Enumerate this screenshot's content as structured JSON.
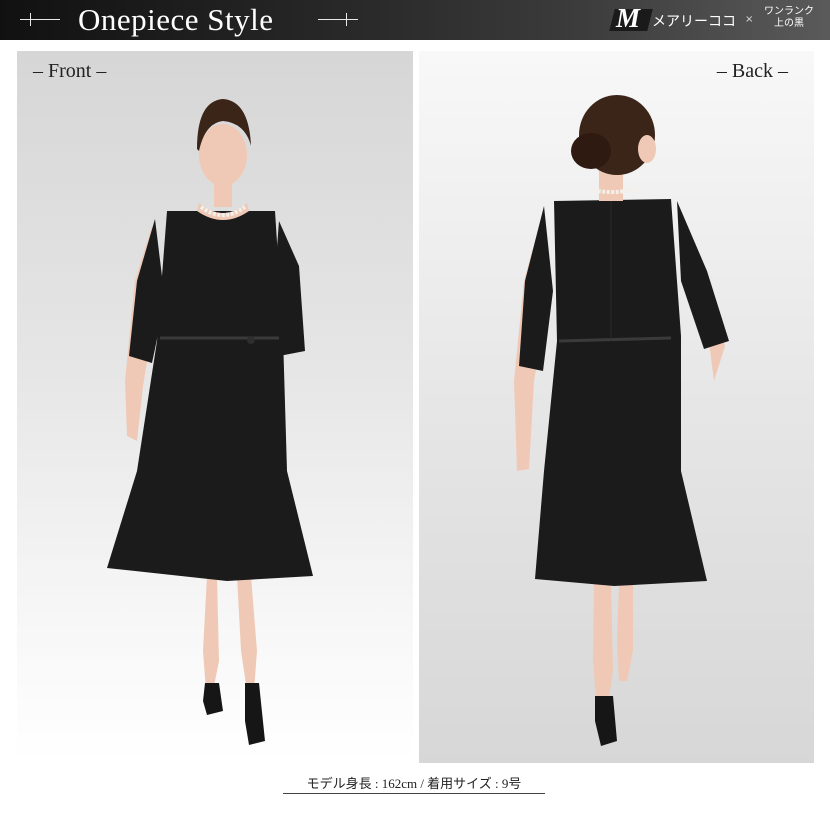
{
  "header": {
    "title": "Onepiece Style",
    "brand": {
      "logo_letter": "M",
      "name": "メアリーココ",
      "separator": "×",
      "sub_line1": "ワンランク",
      "sub_line2": "上の黒"
    }
  },
  "panels": {
    "front_label": "– Front –",
    "back_label": "– Back –"
  },
  "caption": "モデル身長 : 162cm / 着用サイズ : 9号",
  "colors": {
    "banner_dark": "#111111",
    "banner_light": "#5a5a5a",
    "dress": "#1b1b1b",
    "skin": "#f0c9b6",
    "hair": "#3b2418"
  }
}
